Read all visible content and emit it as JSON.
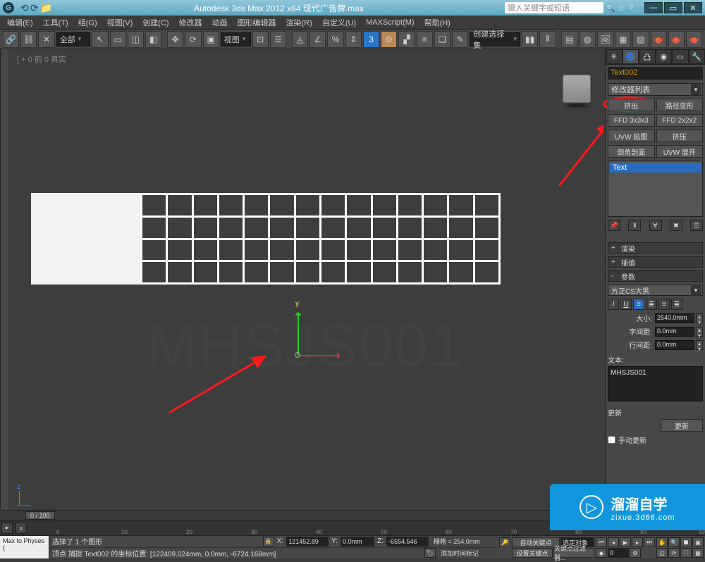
{
  "title": "Autodesk 3ds Max 2012 x64    现代广告牌.max",
  "searchPlaceholder": "键入关键字或短语",
  "menus": [
    "编辑(E)",
    "工具(T)",
    "组(G)",
    "视图(V)",
    "创建(C)",
    "修改器",
    "动画",
    "图形编辑器",
    "渲染(R)",
    "自定义(U)",
    "MAXScript(M)",
    "帮助(H)"
  ],
  "toolbar": {
    "selSet": "全部",
    "viewLabel": "视图",
    "createSel": "创建选择集"
  },
  "viewport": {
    "label": "[ + 0 前 0 真实"
  },
  "watermark": "MHSJS001",
  "panel": {
    "objName": "Text002",
    "modList": "修改器列表",
    "mods": {
      "r1a": "挤出",
      "r1b": "路径变形",
      "r2a": "FFD 3x3x3",
      "r2b": "FFD 2x2x2",
      "r3a": "UVW 贴图",
      "r3b": "挤压",
      "r4a": "倒角剖面",
      "r4b": "UVW 展开"
    },
    "stackSel": "Text",
    "roll1": "渲染",
    "roll2": "插值",
    "roll3": "参数",
    "font": "方正CS大黑",
    "sizeLbl": "大小:",
    "sizeVal": "2540.0mm",
    "kernLbl": "字间距:",
    "kernVal": "0.0mm",
    "leadLbl": "行间距:",
    "leadVal": "0.0mm",
    "textLbl": "文本:",
    "textVal": "MHSJS001",
    "updSection": "更新",
    "updBtn": "更新",
    "manualCk": "手动更新"
  },
  "time": {
    "slider": "0 / 100"
  },
  "status": {
    "maxscript": "Max to Physes (",
    "line1": "选择了 1 个图形",
    "x": "121452.89",
    "y": "0.0mm",
    "z": "-6554.546",
    "grid": "栅格 = 254.0mm",
    "line2": "顶点 捕捉 Text002 的坐标位置: [122409.024mm, 0.0mm, -6724.168mm]",
    "addTime": "添加时间标记",
    "autoKey": "自动关键点",
    "selSet2": "选定对象",
    "setKey": "设置关键点",
    "keyFilter": "关键点过滤器..."
  },
  "promo": {
    "name": "溜溜自学",
    "url": "zixue.3d66.com"
  }
}
